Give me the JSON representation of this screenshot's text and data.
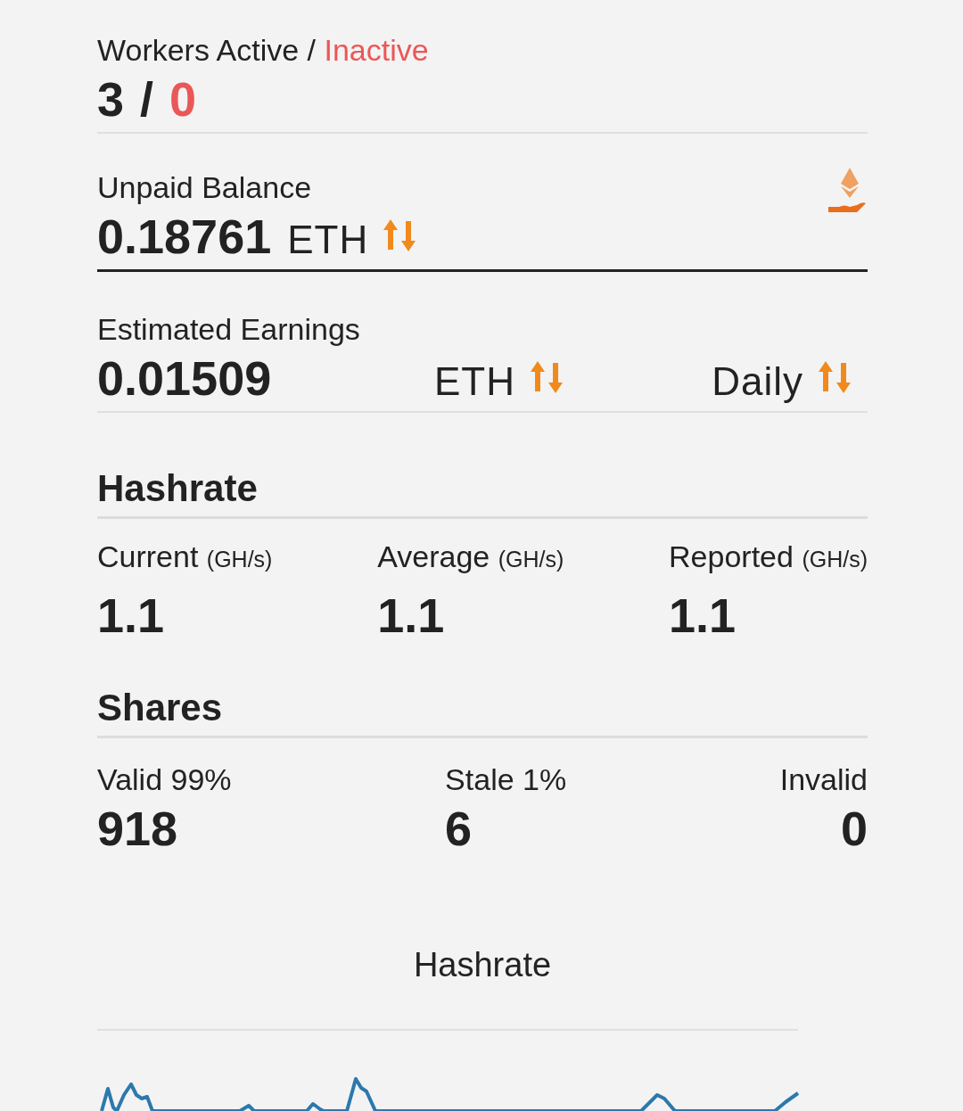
{
  "workers": {
    "label": "Workers Active /",
    "label_inactive": "Inactive",
    "active": "3",
    "separator": "/",
    "inactive": "0"
  },
  "unpaid_balance": {
    "label": "Unpaid Balance",
    "value": "0.18761",
    "unit": "ETH"
  },
  "estimated_earnings": {
    "label": "Estimated Earnings",
    "value": "0.01509",
    "unit": "ETH",
    "period": "Daily"
  },
  "hashrate": {
    "title": "Hashrate",
    "columns": [
      {
        "label": "Current",
        "unit": "(GH/s)",
        "value": "1.1"
      },
      {
        "label": "Average",
        "unit": "(GH/s)",
        "value": "1.1"
      },
      {
        "label": "Reported",
        "unit": "(GH/s)",
        "value": "1.1"
      }
    ]
  },
  "shares": {
    "title": "Shares",
    "columns": [
      {
        "label": "Valid 99%",
        "value": "918"
      },
      {
        "label": "Stale 1%",
        "value": "6"
      },
      {
        "label": "Invalid",
        "value": "0"
      }
    ]
  },
  "chart": {
    "title": "Hashrate"
  }
}
